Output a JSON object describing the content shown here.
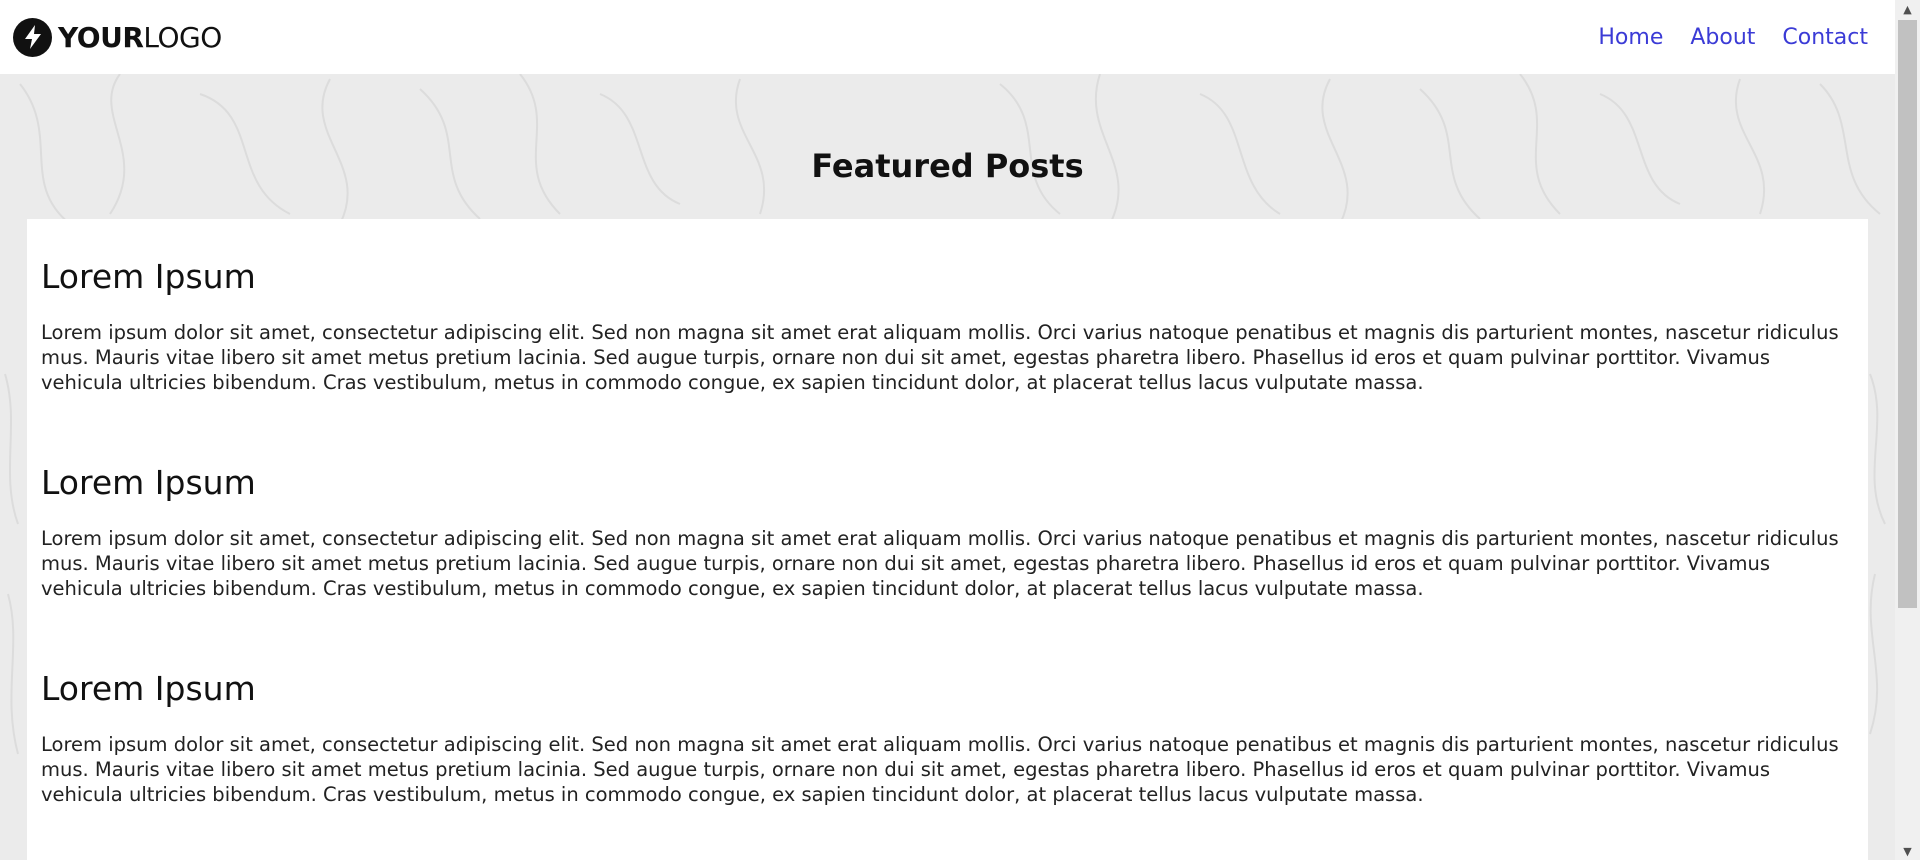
{
  "header": {
    "logo_bold": "YOUR",
    "logo_light": "LOGO",
    "logo_icon": "lightning-bolt-icon",
    "nav": [
      {
        "label": "Home"
      },
      {
        "label": "About"
      },
      {
        "label": "Contact"
      }
    ]
  },
  "hero": {
    "title": "Featured Posts"
  },
  "posts": [
    {
      "title": "Lorem Ipsum",
      "body": "Lorem ipsum dolor sit amet, consectetur adipiscing elit. Sed non magna sit amet erat aliquam mollis. Orci varius natoque penatibus et magnis dis parturient montes, nascetur ridiculus mus. Mauris vitae libero sit amet metus pretium lacinia. Sed augue turpis, ornare non dui sit amet, egestas pharetra libero. Phasellus id eros et quam pulvinar porttitor. Vivamus vehicula ultricies bibendum. Cras vestibulum, metus in commodo congue, ex sapien tincidunt dolor, at placerat tellus lacus vulputate massa."
    },
    {
      "title": "Lorem Ipsum",
      "body": "Lorem ipsum dolor sit amet, consectetur adipiscing elit. Sed non magna sit amet erat aliquam mollis. Orci varius natoque penatibus et magnis dis parturient montes, nascetur ridiculus mus. Mauris vitae libero sit amet metus pretium lacinia. Sed augue turpis, ornare non dui sit amet, egestas pharetra libero. Phasellus id eros et quam pulvinar porttitor. Vivamus vehicula ultricies bibendum. Cras vestibulum, metus in commodo congue, ex sapien tincidunt dolor, at placerat tellus lacus vulputate massa."
    },
    {
      "title": "Lorem Ipsum",
      "body": "Lorem ipsum dolor sit amet, consectetur adipiscing elit. Sed non magna sit amet erat aliquam mollis. Orci varius natoque penatibus et magnis dis parturient montes, nascetur ridiculus mus. Mauris vitae libero sit amet metus pretium lacinia. Sed augue turpis, ornare non dui sit amet, egestas pharetra libero. Phasellus id eros et quam pulvinar porttitor. Vivamus vehicula ultricies bibendum. Cras vestibulum, metus in commodo congue, ex sapien tincidunt dolor, at placerat tellus lacus vulputate massa."
    }
  ],
  "colors": {
    "nav_link": "#3b3bd6",
    "hero_background": "#ebebeb",
    "card_background": "#ffffff"
  },
  "scrollbar": {
    "up_icon": "scroll-up-arrow-icon",
    "down_icon": "scroll-down-arrow-icon"
  }
}
